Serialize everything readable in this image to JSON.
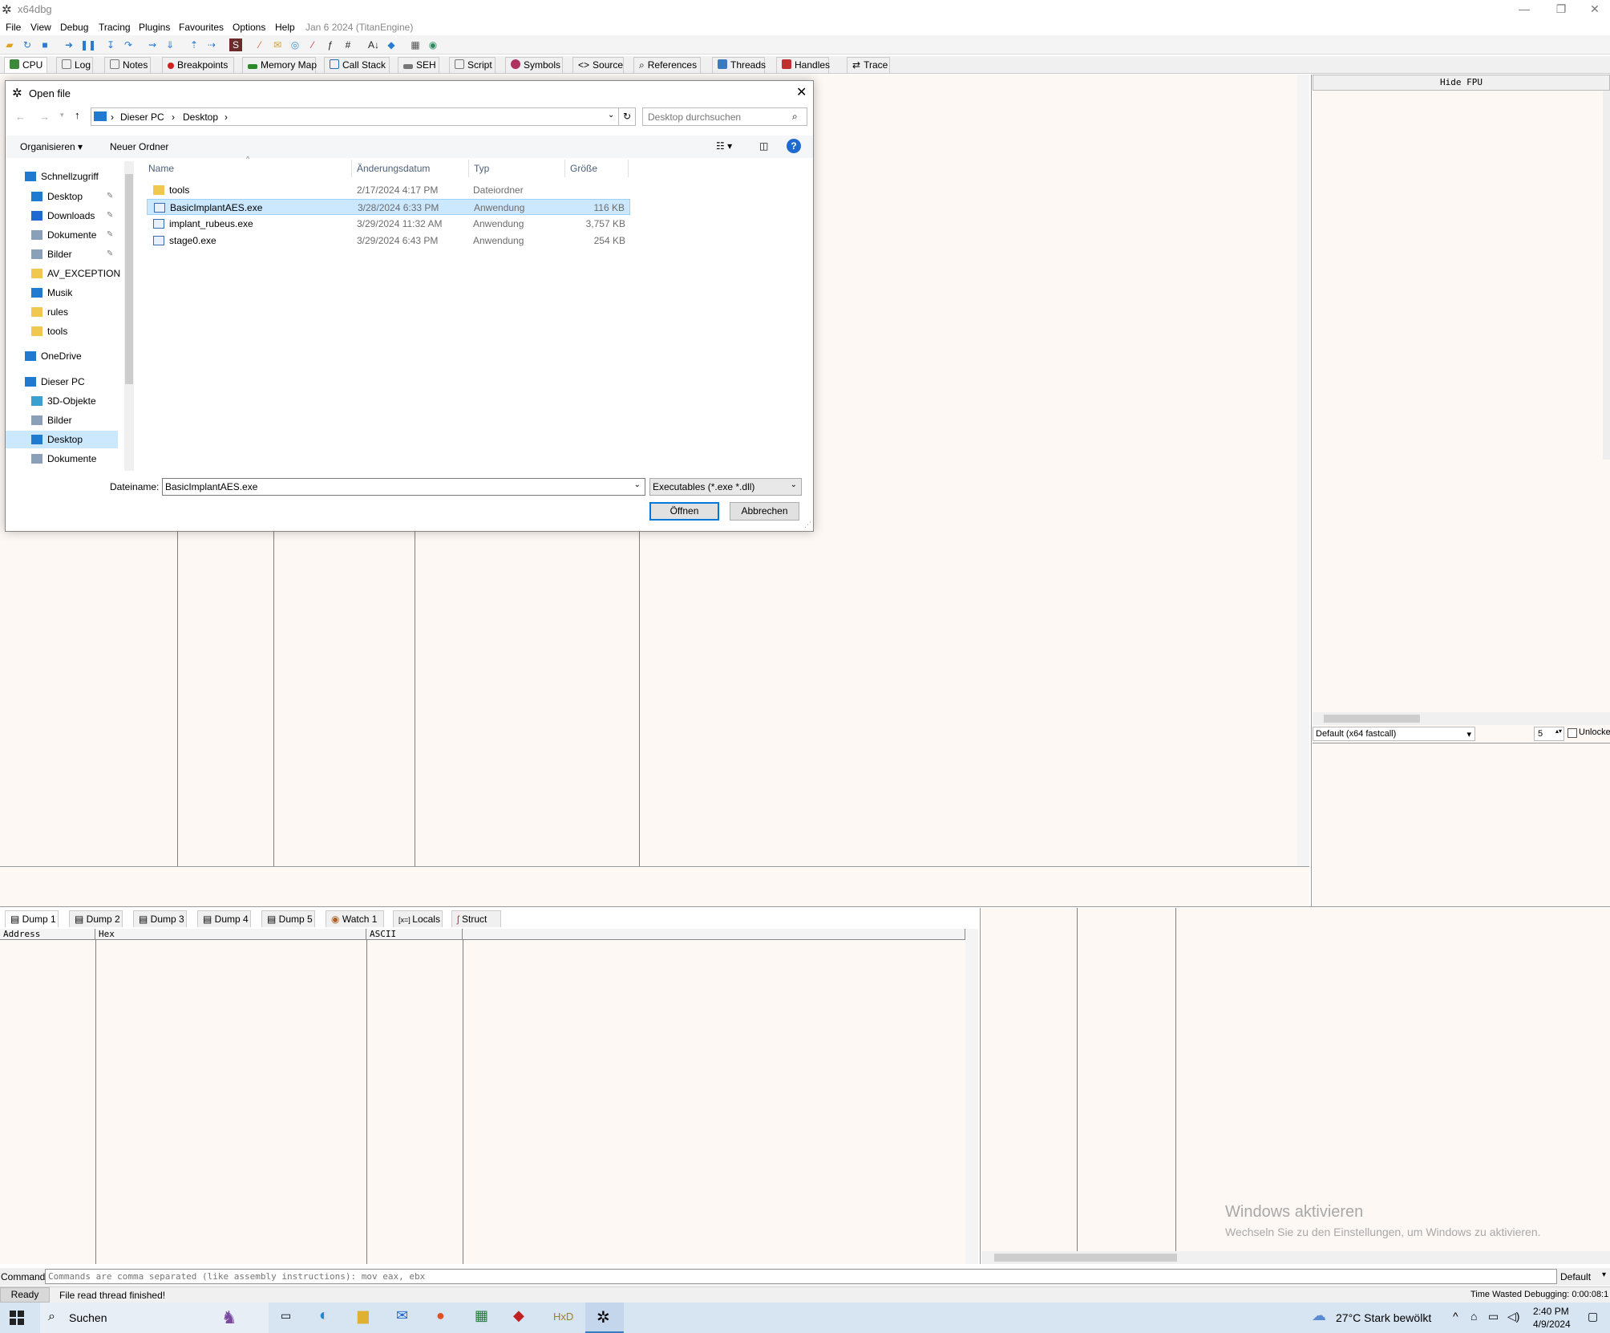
{
  "window": {
    "title": "x64dbg"
  },
  "menu": {
    "items": [
      "File",
      "View",
      "Debug",
      "Tracing",
      "Plugins",
      "Favourites",
      "Options",
      "Help"
    ],
    "date": "Jan 6 2024 (TitanEngine)"
  },
  "tabs": [
    "CPU",
    "Log",
    "Notes",
    "Breakpoints",
    "Memory Map",
    "Call Stack",
    "SEH",
    "Script",
    "Symbols",
    "Source",
    "References",
    "Threads",
    "Handles",
    "Trace"
  ],
  "right_panel": {
    "hide_fpu": "Hide FPU",
    "calling_convention": "Default (x64 fastcall)",
    "arg_count": "5",
    "unlock_label": "Unlocke"
  },
  "dump_tabs": [
    "Dump 1",
    "Dump 2",
    "Dump 3",
    "Dump 4",
    "Dump 5",
    "Watch 1",
    "Locals",
    "Struct"
  ],
  "dump_columns": [
    "Address",
    "Hex",
    "ASCII"
  ],
  "command": {
    "label": "Command:",
    "placeholder": "Commands are comma separated (like assembly instructions): mov eax, ebx",
    "mode": "Default"
  },
  "status": {
    "state": "Ready",
    "message": "File read thread finished!",
    "time_wasted": "Time Wasted Debugging: 0:00:08:1"
  },
  "activation": {
    "title": "Windows aktivieren",
    "text": "Wechseln Sie zu den Einstellungen, um Windows zu aktivieren."
  },
  "taskbar": {
    "search": "Suchen",
    "weather": "27°C  Stark bewölkt",
    "time": "2:40 PM",
    "date": "4/9/2024"
  },
  "dialog": {
    "title": "Open file",
    "breadcrumb": [
      "Dieser PC",
      "Desktop"
    ],
    "search_placeholder": "Desktop durchsuchen",
    "organize": "Organisieren",
    "new_folder": "Neuer Ordner",
    "nav": [
      {
        "label": "Schnellzugriff",
        "level": 0
      },
      {
        "label": "Desktop",
        "level": 1,
        "pinned": true
      },
      {
        "label": "Downloads",
        "level": 1,
        "pinned": true
      },
      {
        "label": "Dokumente",
        "level": 1,
        "pinned": true
      },
      {
        "label": "Bilder",
        "level": 1,
        "pinned": true
      },
      {
        "label": "AV_EXCEPTION",
        "level": 1
      },
      {
        "label": "Musik",
        "level": 1
      },
      {
        "label": "rules",
        "level": 1
      },
      {
        "label": "tools",
        "level": 1
      },
      {
        "label": "OneDrive",
        "level": 0
      },
      {
        "label": "Dieser PC",
        "level": 0
      },
      {
        "label": "3D-Objekte",
        "level": 1
      },
      {
        "label": "Bilder",
        "level": 1
      },
      {
        "label": "Desktop",
        "level": 1,
        "selected": true
      },
      {
        "label": "Dokumente",
        "level": 1
      }
    ],
    "columns": {
      "name": "Name",
      "date": "Änderungsdatum",
      "type": "Typ",
      "size": "Größe"
    },
    "files": [
      {
        "name": "tools",
        "date": "2/17/2024 4:17 PM",
        "type": "Dateiordner",
        "size": "",
        "folder": true
      },
      {
        "name": "BasicImplantAES.exe",
        "date": "3/28/2024 6:33 PM",
        "type": "Anwendung",
        "size": "116 KB",
        "selected": true
      },
      {
        "name": "implant_rubeus.exe",
        "date": "3/29/2024 11:32 AM",
        "type": "Anwendung",
        "size": "3,757 KB"
      },
      {
        "name": "stage0.exe",
        "date": "3/29/2024 6:43 PM",
        "type": "Anwendung",
        "size": "254 KB"
      }
    ],
    "filename_label": "Dateiname:",
    "filename": "BasicImplantAES.exe",
    "filter": "Executables (*.exe *.dll)",
    "open": "Öffnen",
    "cancel": "Abbrechen"
  },
  "colors": {
    "pane_bg": "#fef8f4",
    "selection": "#cce8ff",
    "accent": "#0078d7"
  }
}
